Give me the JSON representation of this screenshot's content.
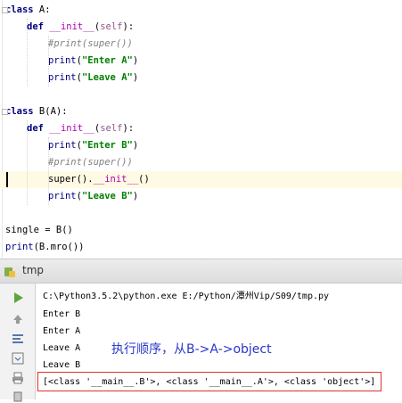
{
  "editor": {
    "lines": [
      {
        "indent": 0,
        "tokens": [
          {
            "t": "class",
            "c": "kw"
          },
          {
            "t": " A:",
            "c": ""
          }
        ]
      },
      {
        "indent": 1,
        "tokens": [
          {
            "t": "def",
            "c": "kw"
          },
          {
            "t": " ",
            "c": ""
          },
          {
            "t": "__init__",
            "c": "fn-dunder"
          },
          {
            "t": "(",
            "c": ""
          },
          {
            "t": "self",
            "c": "self"
          },
          {
            "t": "):",
            "c": ""
          }
        ]
      },
      {
        "indent": 2,
        "tokens": [
          {
            "t": "#print(super())",
            "c": "cmt"
          }
        ]
      },
      {
        "indent": 2,
        "tokens": [
          {
            "t": "print",
            "c": "builtin"
          },
          {
            "t": "(",
            "c": ""
          },
          {
            "t": "\"Enter A\"",
            "c": "str"
          },
          {
            "t": ")",
            "c": ""
          }
        ]
      },
      {
        "indent": 2,
        "tokens": [
          {
            "t": "print",
            "c": "builtin"
          },
          {
            "t": "(",
            "c": ""
          },
          {
            "t": "\"Leave A\"",
            "c": "str"
          },
          {
            "t": ")",
            "c": ""
          }
        ]
      },
      {
        "indent": 0,
        "tokens": []
      },
      {
        "indent": 0,
        "tokens": [
          {
            "t": "class",
            "c": "kw"
          },
          {
            "t": " B(A):",
            "c": ""
          }
        ]
      },
      {
        "indent": 1,
        "tokens": [
          {
            "t": "def",
            "c": "kw"
          },
          {
            "t": " ",
            "c": ""
          },
          {
            "t": "__init__",
            "c": "fn-dunder"
          },
          {
            "t": "(",
            "c": ""
          },
          {
            "t": "self",
            "c": "self"
          },
          {
            "t": "):",
            "c": ""
          }
        ]
      },
      {
        "indent": 2,
        "tokens": [
          {
            "t": "print",
            "c": "builtin"
          },
          {
            "t": "(",
            "c": ""
          },
          {
            "t": "\"Enter B\"",
            "c": "str"
          },
          {
            "t": ")",
            "c": ""
          }
        ]
      },
      {
        "indent": 2,
        "tokens": [
          {
            "t": "#print(super())",
            "c": "cmt"
          }
        ]
      },
      {
        "indent": 2,
        "tokens": [
          {
            "t": "super",
            "c": ""
          },
          {
            "t": "().",
            "c": ""
          },
          {
            "t": "__init__",
            "c": "fn-dunder"
          },
          {
            "t": "()",
            "c": ""
          }
        ]
      },
      {
        "indent": 2,
        "tokens": [
          {
            "t": "print",
            "c": "builtin"
          },
          {
            "t": "(",
            "c": ""
          },
          {
            "t": "\"Leave B\"",
            "c": "str"
          },
          {
            "t": ")",
            "c": ""
          }
        ]
      },
      {
        "indent": 0,
        "tokens": []
      },
      {
        "indent": 0,
        "tokens": [
          {
            "t": "single = B()",
            "c": ""
          }
        ]
      },
      {
        "indent": 0,
        "tokens": [
          {
            "t": "print",
            "c": "builtin"
          },
          {
            "t": "(B.mro())",
            "c": ""
          }
        ]
      }
    ],
    "caret_line_index": 10
  },
  "run_panel": {
    "tab_title": "tmp",
    "icons": [
      "run-icon",
      "arrow-up-icon",
      "arrow-down-icon",
      "soft-wrap-icon",
      "scroll-to-end-icon",
      "print-icon"
    ],
    "output_lines": [
      "C:\\Python3.5.2\\python.exe E:/Python/潭州Vip/S09/tmp.py",
      "Enter B",
      "Enter A",
      "Leave A",
      "Leave B",
      "[<class '__main__.B'>, <class '__main__.A'>, <class 'object'>]"
    ],
    "annotation": "执行顺序，从B->A->object",
    "colors": {
      "annotation": "#2a36c9",
      "highlight_box": "#e0302b"
    }
  }
}
